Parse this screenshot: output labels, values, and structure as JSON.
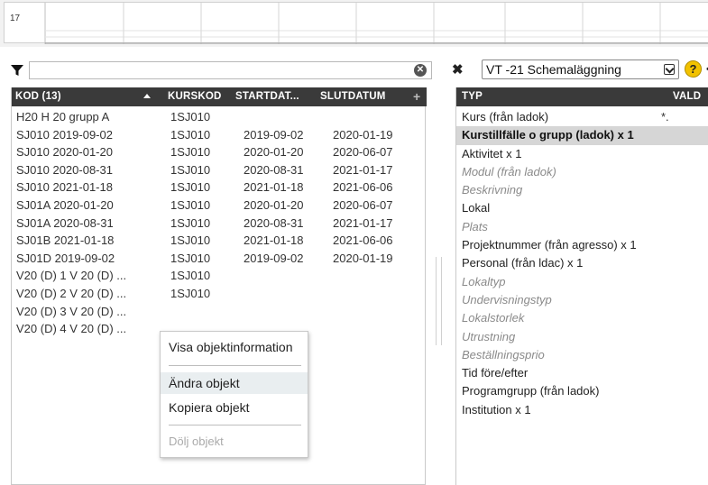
{
  "calendar": {
    "week_number": "17"
  },
  "filter": {
    "value": "",
    "placeholder": ""
  },
  "left_table": {
    "columns": [
      "KOD (13)",
      "KURSKOD",
      "STARTDAT...",
      "SLUTDATUM"
    ],
    "rows": [
      [
        "H20 H 20 grupp A",
        "1SJ010",
        "",
        ""
      ],
      [
        "SJ010 2019-09-02",
        "1SJ010",
        "2019-09-02",
        "2020-01-19"
      ],
      [
        "SJ010 2020-01-20",
        "1SJ010",
        "2020-01-20",
        "2020-06-07"
      ],
      [
        "SJ010 2020-08-31",
        "1SJ010",
        "2020-08-31",
        "2021-01-17"
      ],
      [
        "SJ010 2021-01-18",
        "1SJ010",
        "2021-01-18",
        "2021-06-06"
      ],
      [
        "SJ01A 2020-01-20",
        "1SJ010",
        "2020-01-20",
        "2020-06-07"
      ],
      [
        "SJ01A 2020-08-31",
        "1SJ010",
        "2020-08-31",
        "2021-01-17"
      ],
      [
        "SJ01B 2021-01-18",
        "1SJ010",
        "2021-01-18",
        "2021-06-06"
      ],
      [
        "SJ01D 2019-09-02",
        "1SJ010",
        "2019-09-02",
        "2020-01-19"
      ],
      [
        "V20 (D) 1 V 20 (D) ...",
        "1SJ010",
        "",
        ""
      ],
      [
        "V20 (D) 2 V 20 (D) ...",
        "1SJ010",
        "",
        ""
      ],
      [
        "V20 (D) 3 V 20 (D) ...",
        "",
        "",
        ""
      ],
      [
        "V20 (D) 4 V 20 (D) ...",
        "",
        "",
        ""
      ]
    ]
  },
  "schema": {
    "selected": "VT -21 Schemaläggning"
  },
  "right_table": {
    "columns": [
      "TYP",
      "VALD"
    ],
    "rows": [
      {
        "label": "Kurs (från ladok)",
        "value": "*.",
        "state": "normal"
      },
      {
        "label": "Kurstillfälle o grupp (ladok) x 1",
        "value": "",
        "state": "selected"
      },
      {
        "label": "Aktivitet x 1",
        "value": "",
        "state": "normal"
      },
      {
        "label": "Modul (från ladok)",
        "value": "",
        "state": "inactive"
      },
      {
        "label": "Beskrivning",
        "value": "",
        "state": "inactive"
      },
      {
        "label": "Lokal",
        "value": "",
        "state": "normal"
      },
      {
        "label": "Plats",
        "value": "",
        "state": "inactive"
      },
      {
        "label": "Projektnummer (från agresso) x 1",
        "value": "",
        "state": "normal"
      },
      {
        "label": "Personal (från ldac) x 1",
        "value": "",
        "state": "normal"
      },
      {
        "label": "Lokaltyp",
        "value": "",
        "state": "inactive"
      },
      {
        "label": "Undervisningstyp",
        "value": "",
        "state": "inactive"
      },
      {
        "label": "Lokalstorlek",
        "value": "",
        "state": "inactive"
      },
      {
        "label": "Utrustning",
        "value": "",
        "state": "inactive"
      },
      {
        "label": "Beställningsprio",
        "value": "",
        "state": "inactive"
      },
      {
        "label": "Tid före/efter",
        "value": "",
        "state": "normal"
      },
      {
        "label": "Programgrupp (från ladok)",
        "value": "",
        "state": "normal"
      },
      {
        "label": "Institution x 1",
        "value": "",
        "state": "normal"
      }
    ]
  },
  "context_menu": {
    "items": [
      {
        "label": "Visa objektinformation",
        "state": "normal"
      },
      {
        "label": "Ändra objekt",
        "state": "hover"
      },
      {
        "label": "Kopiera objekt",
        "state": "normal"
      },
      {
        "label": "Dölj objekt",
        "state": "disabled"
      }
    ]
  },
  "icons": [
    "filter-funnel-icon",
    "clear-circle-icon",
    "sort-ascending-icon",
    "add-column-icon",
    "close-x-icon",
    "dropdown-chevron-icon",
    "help-question-icon",
    "back-chevron-icon"
  ],
  "colors": {
    "header_bg": "#3a3a3a",
    "selected_row": "#d6d6d6",
    "help_icon": "#f2c200",
    "menu_hover": "#e9eef0"
  }
}
